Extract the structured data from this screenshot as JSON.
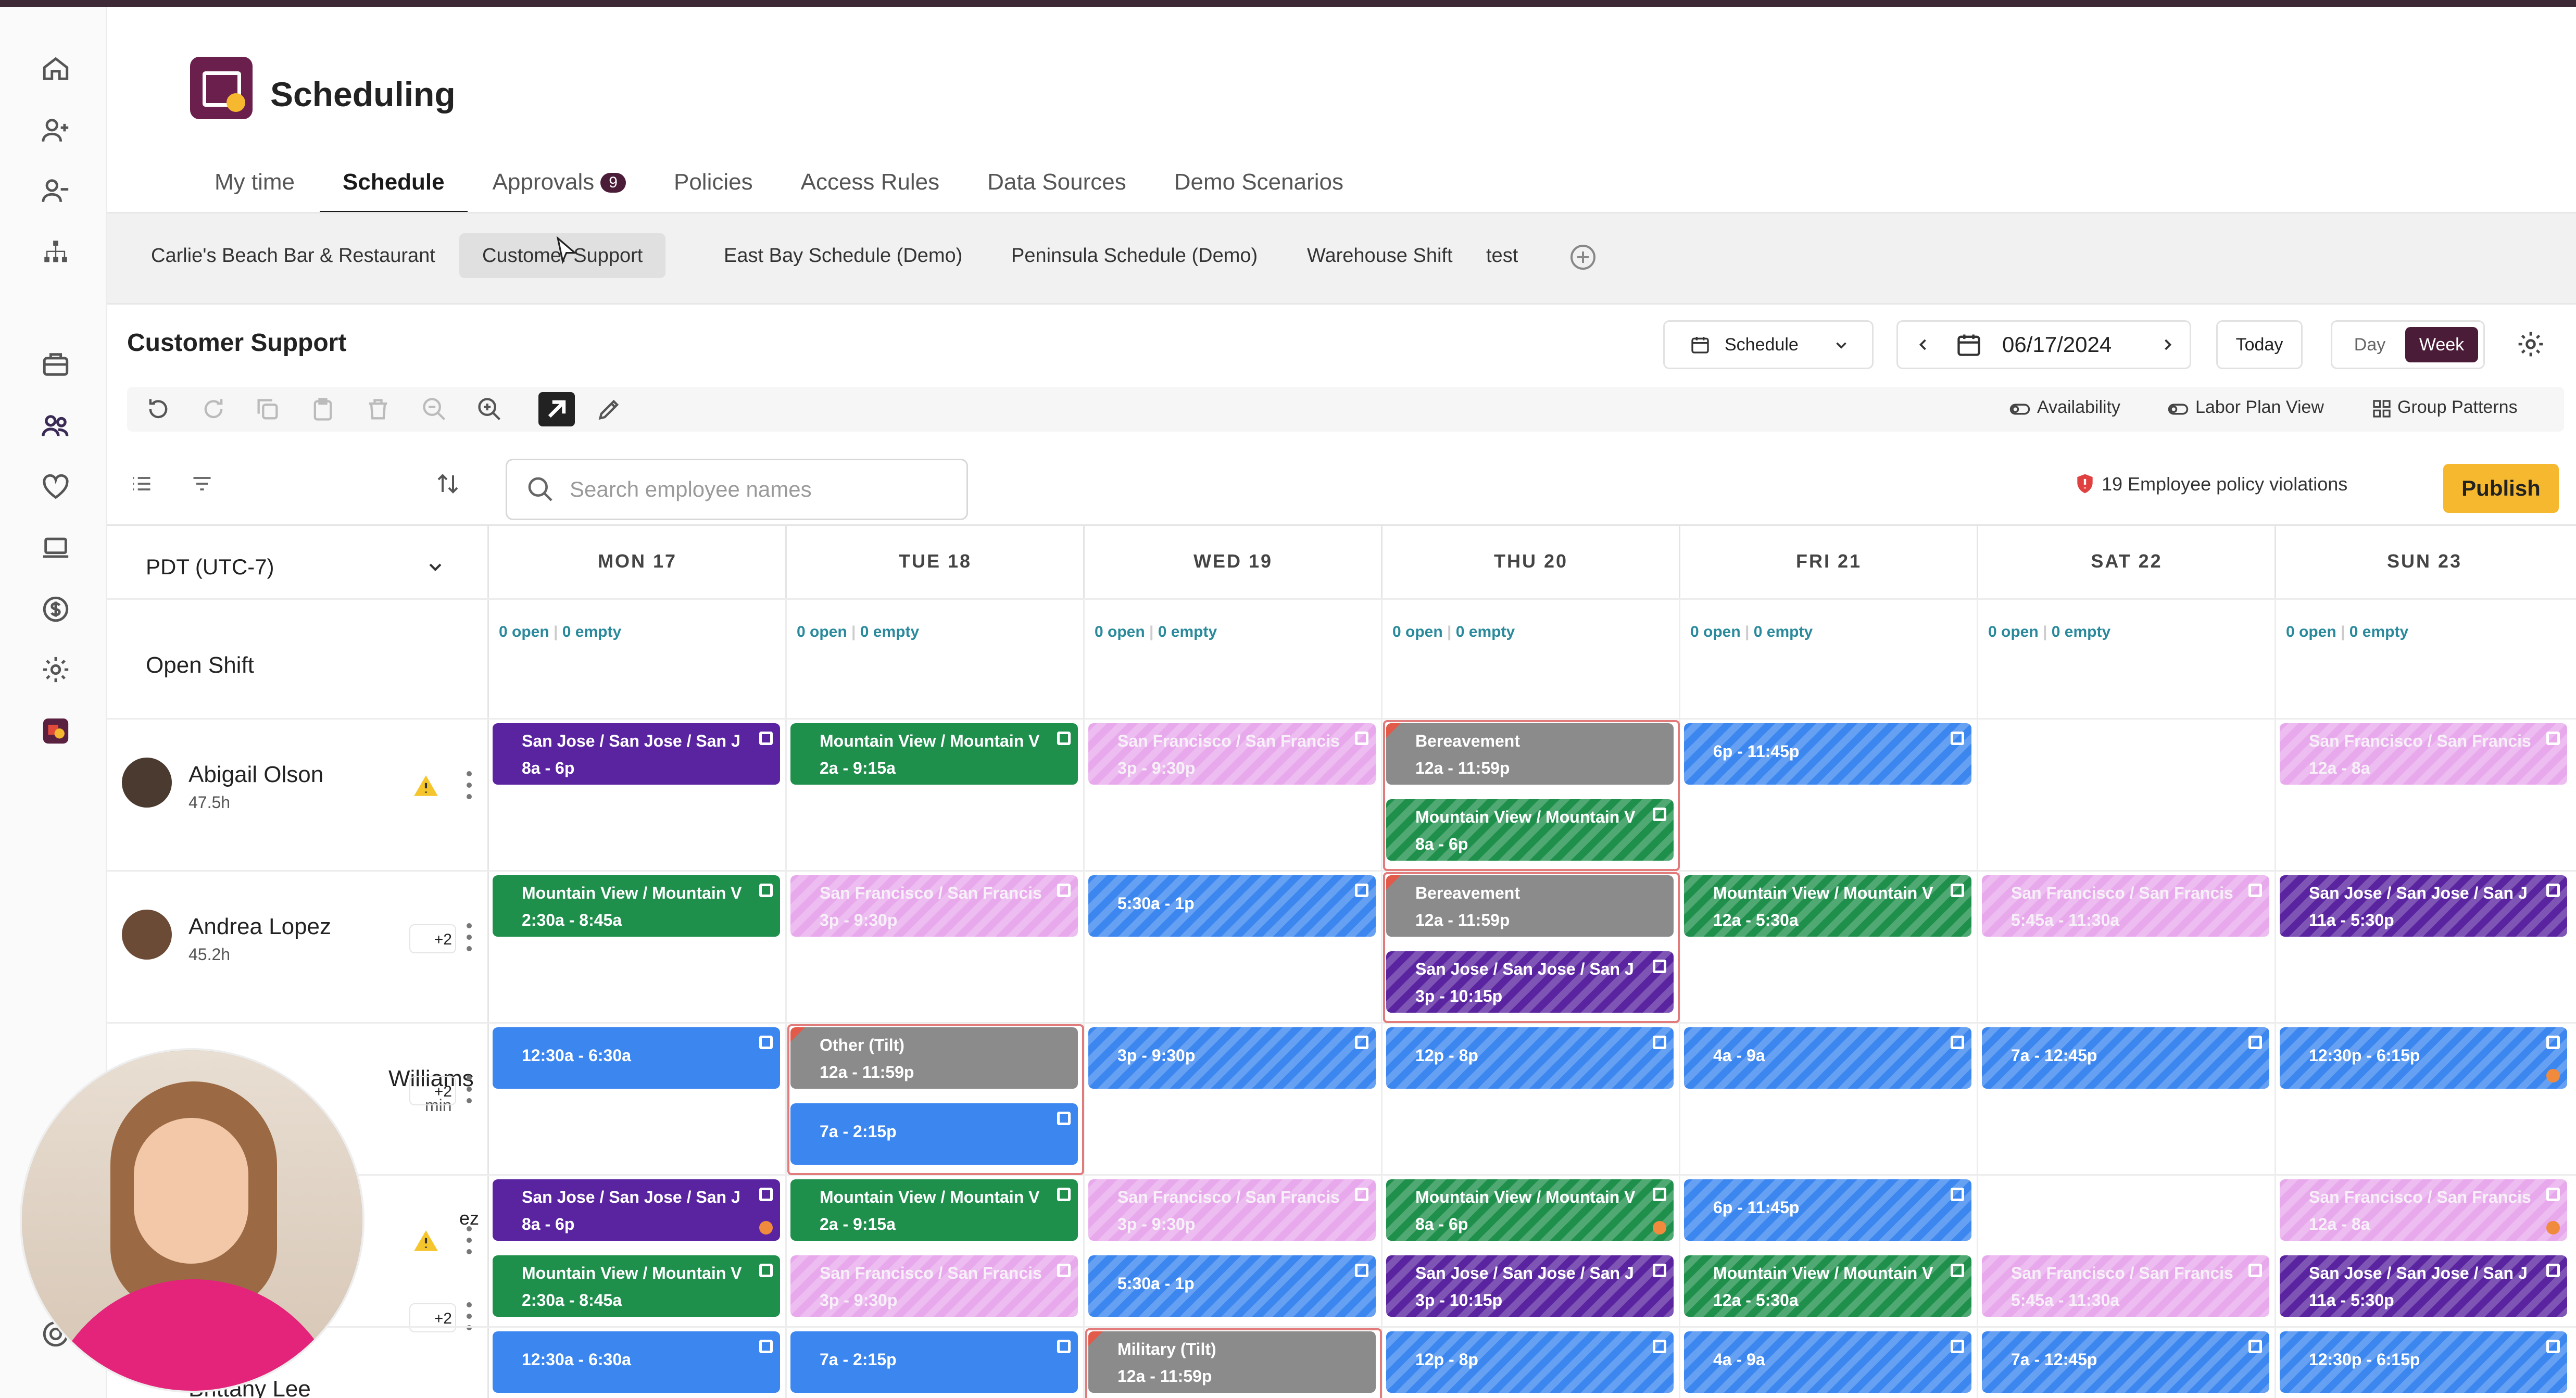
{
  "app": {
    "title": "Scheduling"
  },
  "nav_tabs": [
    {
      "label": "My time"
    },
    {
      "label": "Schedule"
    },
    {
      "label": "Approvals",
      "badge": "9"
    },
    {
      "label": "Policies"
    },
    {
      "label": "Access Rules"
    },
    {
      "label": "Data Sources"
    },
    {
      "label": "Demo Scenarios"
    }
  ],
  "schedule_tabs": [
    "Carlie's Beach Bar & Restaurant",
    "Customer Support",
    "East Bay Schedule (Demo)",
    "Peninsula Schedule (Demo)",
    "Warehouse Shift",
    "test"
  ],
  "schedule": {
    "title": "Customer Support",
    "view": "Schedule",
    "date": "06/17/2024",
    "today": "Today",
    "day": "Day",
    "week": "Week"
  },
  "toolbar": {
    "availability": "Availability",
    "labor_plan": "Labor Plan View",
    "group_patterns": "Group Patterns"
  },
  "search": {
    "placeholder": "Search employee names"
  },
  "violations": "19 Employee policy violations",
  "publish": "Publish",
  "timezone": "PDT (UTC-7)",
  "open_shift": {
    "label": "Open Shift",
    "open": "0 open",
    "sep": "|",
    "empty": "0 empty"
  },
  "days": [
    "MON 17",
    "TUE 18",
    "WED 19",
    "THU 20",
    "FRI 21",
    "SAT 22",
    "SUN 23"
  ],
  "employees": [
    {
      "name": "Abigail Olson",
      "hours": "47.5h",
      "alert": ""
    },
    {
      "name": "Andrea Lopez",
      "hours": "45.2h",
      "alert": "+2"
    },
    {
      "name": "Williams",
      "hours": "min",
      "alert": "+2"
    },
    {
      "name": "ez",
      "hours": "",
      "alert": ""
    },
    {
      "name": "",
      "hours": "",
      "alert": "+2"
    },
    {
      "name": "Brittany Lee",
      "hours": "",
      "alert": ""
    }
  ],
  "shifts": {
    "r0": [
      {
        "t1": "San Jose / San Jose / San J",
        "t2": "8a - 6p"
      },
      {
        "t1": "Mountain View / Mountain V",
        "t2": "2a - 9:15a"
      },
      {
        "t1": "San Francisco / San Francis",
        "t2": "3p - 9:30p"
      },
      {
        "t1": "Bereavement",
        "t2": "12a - 11:59p"
      },
      {
        "t1": "Mountain View / Mountain V",
        "t2": "8a - 6p"
      },
      {
        "t1": "6p - 11:45p"
      },
      {
        "t1": "San Francisco / San Francis",
        "t2": "12a - 8a"
      }
    ],
    "r1": [
      {
        "t1": "Mountain View / Mountain V",
        "t2": "2:30a - 8:45a"
      },
      {
        "t1": "San Francisco / San Francis",
        "t2": "3p - 9:30p"
      },
      {
        "t1": "5:30a - 1p"
      },
      {
        "t1": "Bereavement",
        "t2": "12a - 11:59p"
      },
      {
        "t1": "San Jose / San Jose / San J",
        "t2": "3p - 10:15p"
      },
      {
        "t1": "Mountain View / Mountain V",
        "t2": "12a - 5:30a"
      },
      {
        "t1": "San Francisco / San Francis",
        "t2": "5:45a - 11:30a"
      },
      {
        "t1": "San Jose / San Jose / San J",
        "t2": "11a - 5:30p"
      }
    ],
    "r2": [
      {
        "t1": "12:30a - 6:30a"
      },
      {
        "t1": "Other (Tilt)",
        "t2": "12a - 11:59p"
      },
      {
        "t1": "7a - 2:15p"
      },
      {
        "t1": "3p - 9:30p"
      },
      {
        "t1": "12p - 8p"
      },
      {
        "t1": "4a - 9a"
      },
      {
        "t1": "7a - 12:45p"
      },
      {
        "t1": "12:30p - 6:15p"
      }
    ],
    "r3": [
      {
        "t1": "San Jose / San Jose / San J",
        "t2": "8a - 6p"
      },
      {
        "t1": "Mountain View / Mountain V",
        "t2": "2a - 9:15a"
      },
      {
        "t1": "San Francisco / San Francis",
        "t2": "3p - 9:30p"
      },
      {
        "t1": "Mountain View / Mountain V",
        "t2": "8a - 6p"
      },
      {
        "t1": "6p - 11:45p"
      },
      {
        "t1": "San Francisco / San Francis",
        "t2": "12a - 8a"
      }
    ],
    "r4": [
      {
        "t1": "Mountain View / Mountain V",
        "t2": "2:30a - 8:45a"
      },
      {
        "t1": "San Francisco / San Francis",
        "t2": "3p - 9:30p"
      },
      {
        "t1": "5:30a - 1p"
      },
      {
        "t1": "San Jose / San Jose / San J",
        "t2": "3p - 10:15p"
      },
      {
        "t1": "Mountain View / Mountain V",
        "t2": "12a - 5:30a"
      },
      {
        "t1": "San Francisco / San Francis",
        "t2": "5:45a - 11:30a"
      },
      {
        "t1": "San Jose / San Jose / San J",
        "t2": "11a - 5:30p"
      }
    ],
    "r5": [
      {
        "t1": "12:30a - 6:30a"
      },
      {
        "t1": "7a - 2:15p"
      },
      {
        "t1": "Military (Tilt)",
        "t2": "12a - 11:59p"
      },
      {
        "t1": "12p - 8p"
      },
      {
        "t1": "4a - 9a"
      },
      {
        "t1": "7a - 12:45p"
      },
      {
        "t1": "12:30p - 6:15p"
      }
    ]
  },
  "colors": {
    "brand": "#4a1c38",
    "publish": "#f5b82e",
    "purple": "#5a24a0",
    "green": "#1f8f4c",
    "blue": "#3b86ef",
    "pink": "#e8a9ec",
    "gray": "#8b8b8b"
  }
}
